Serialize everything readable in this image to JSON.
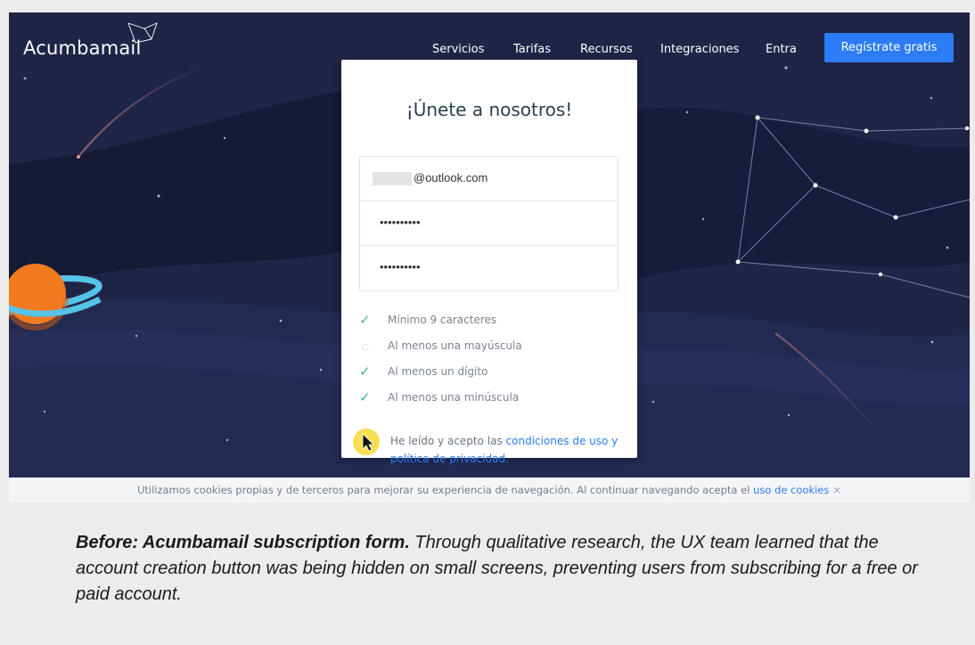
{
  "header": {
    "logo": "Acumbamail",
    "nav": [
      "Servicios",
      "Tarifas",
      "Recursos",
      "Integraciones",
      "Entra"
    ],
    "cta_label": "Regístrate gratis"
  },
  "form": {
    "title": "¡Únete a nosotros!",
    "email_value": "@outlook.com",
    "password_value": "••••••••••",
    "confirm_value": "••••••••••",
    "rules": [
      {
        "label": "Mínimo 9 caracteres",
        "met": true
      },
      {
        "label": "Al menos una mayúscula",
        "met": false
      },
      {
        "label": "Al menos un dígito",
        "met": true
      },
      {
        "label": "Al menos una minúscula",
        "met": true
      }
    ],
    "terms_prefix": "He leído y acepto las ",
    "terms_link": "condiciones de uso y política de privacidad."
  },
  "cookie": {
    "text": "Utilizamos cookies propias y de terceros para mejorar su experiencia de navegación. Al continuar navegando acepta el ",
    "link": "uso de cookies",
    "close": "×"
  },
  "caption": {
    "bold": "Before: Acumbamail subscription form.",
    "text": " Through qualitative research, the UX team learned that the account creation button was being hidden on small screens, preventing users from subscribing for a free or paid account."
  },
  "colors": {
    "sky": "#1f2547",
    "accent": "#2b7cf6",
    "check": "#3fb98d",
    "planet": "#f47a20",
    "ring": "#56c3e8"
  }
}
